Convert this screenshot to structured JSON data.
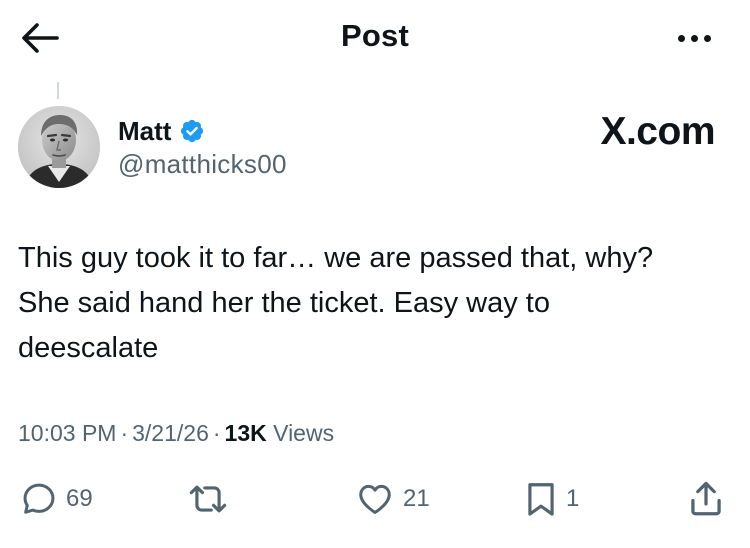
{
  "header": {
    "title": "Post"
  },
  "author": {
    "display_name": "Matt",
    "handle": "@matthicks00",
    "verified": true
  },
  "watermark": "X.com",
  "tweet": {
    "lines": [
      "This guy took it to far… we are passed that, why?",
      "She said hand her the ticket.  Easy way to",
      "deescalate"
    ]
  },
  "meta": {
    "time": "10:03 PM",
    "date": "3/21/26",
    "separator": "·",
    "views_count": "13K",
    "views_label": "Views"
  },
  "actions": {
    "replies": "69",
    "reposts": "",
    "likes": "21",
    "bookmarks": "1"
  },
  "colors": {
    "text": "#0f1419",
    "secondary": "#536471",
    "verified_blue": "#1d9bf0",
    "divider": "#cfd9de"
  },
  "icons": {
    "back": "arrow-left-icon",
    "more": "more-dots-icon",
    "verified": "verified-badge-icon",
    "reply": "reply-bubble-icon",
    "repost": "repost-arrows-icon",
    "like": "heart-icon",
    "bookmark": "bookmark-icon",
    "share": "share-upload-icon"
  }
}
